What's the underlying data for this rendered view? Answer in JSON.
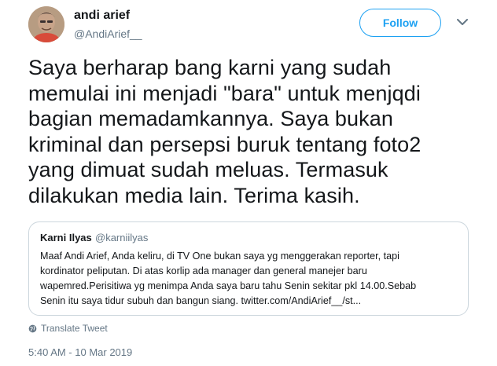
{
  "author": {
    "name": "andi arief",
    "handle": "@AndiArief__"
  },
  "actions": {
    "follow_label": "Follow"
  },
  "tweet": {
    "text": "Saya berharap bang karni yang sudah\nmemulai ini menjadi \"bara\" untuk menjqdi\nbagian memadamkannya. Saya bukan\nkriminal dan persepsi buruk tentang foto2\nyang dimuat sudah meluas. Termasuk\ndilakukan media lain. Terima kasih.",
    "translate_label": "Translate Tweet",
    "timestamp": "5:40 AM - 10 Mar 2019"
  },
  "quoted_tweet": {
    "name": "Karni Ilyas",
    "handle": "@karniilyas",
    "text": "Maaf Andi Arief, Anda keliru, di TV One bukan saya yg menggerakan reporter, tapi\nkordinator peliputan. Di atas korlip ada manager dan general manejer baru\nwapemred.Perisitiwa yg menimpa Anda saya baru tahu Senin sekitar pkl 14.00.Sebab\nSenin itu saya tidur subuh dan bangun siang. twitter.com/AndiArief__/st..."
  },
  "icons": {
    "avatar": "profile-photo",
    "caret": "chevron-down-icon",
    "translate": "globe-icon"
  },
  "colors": {
    "accent": "#1da1f2",
    "secondary_text": "#657786",
    "border": "#ccd6dd"
  }
}
